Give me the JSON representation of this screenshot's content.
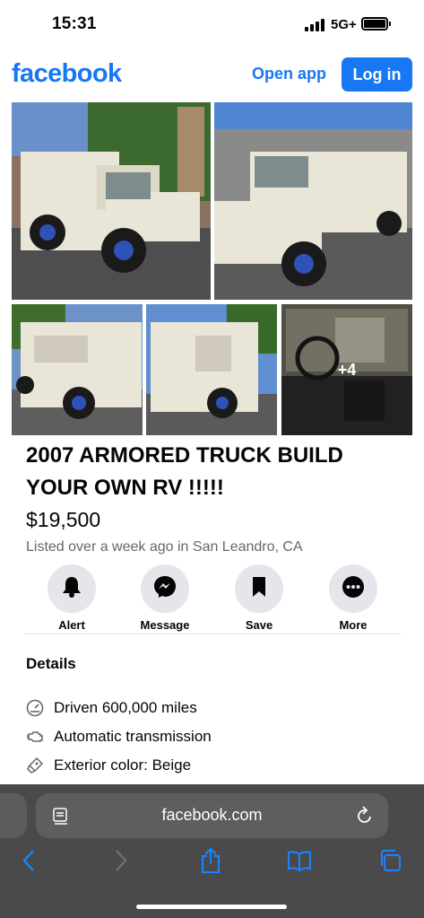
{
  "status_bar": {
    "time": "15:31",
    "network": "5G+"
  },
  "header": {
    "logo": "facebook",
    "open_app_label": "Open app",
    "login_label": "Log in"
  },
  "photos": {
    "more_count_label": "+4"
  },
  "listing": {
    "title": "2007 ARMORED TRUCK BUILD YOUR OWN RV !!!!!",
    "price": "$19,500",
    "listed": "Listed over a week ago in San Leandro, CA"
  },
  "actions": [
    {
      "label": "Alert",
      "icon": "bell-icon"
    },
    {
      "label": "Message",
      "icon": "messenger-icon"
    },
    {
      "label": "Save",
      "icon": "bookmark-icon"
    },
    {
      "label": "More",
      "icon": "more-icon"
    }
  ],
  "details": {
    "heading": "Details",
    "items": [
      {
        "text": "Driven 600,000 miles",
        "icon": "odometer-icon"
      },
      {
        "text": "Automatic transmission",
        "icon": "engine-icon"
      },
      {
        "text": "Exterior color: Beige",
        "icon": "paint-icon"
      }
    ]
  },
  "browser": {
    "url": "facebook.com"
  },
  "colors": {
    "brand": "#1877f2",
    "secondary_text": "#65676b",
    "button_bg": "#e4e6eb"
  }
}
